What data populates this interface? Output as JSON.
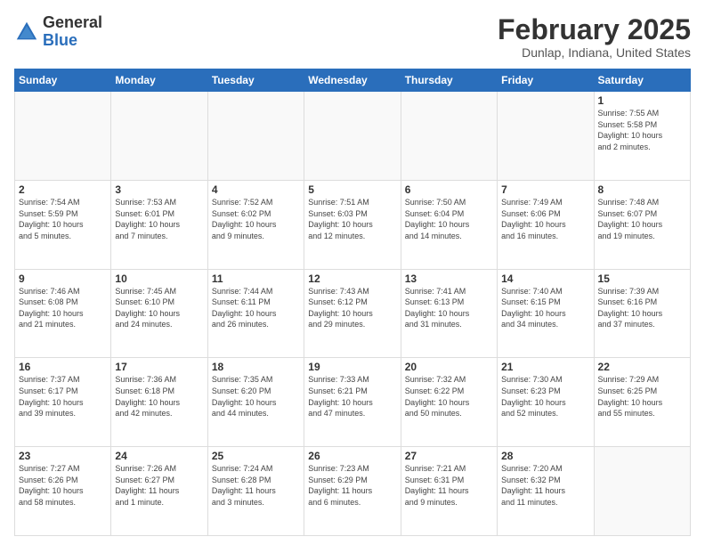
{
  "header": {
    "logo_general": "General",
    "logo_blue": "Blue",
    "main_title": "February 2025",
    "subtitle": "Dunlap, Indiana, United States"
  },
  "calendar": {
    "days_of_week": [
      "Sunday",
      "Monday",
      "Tuesday",
      "Wednesday",
      "Thursday",
      "Friday",
      "Saturday"
    ],
    "weeks": [
      [
        {
          "day": "",
          "info": ""
        },
        {
          "day": "",
          "info": ""
        },
        {
          "day": "",
          "info": ""
        },
        {
          "day": "",
          "info": ""
        },
        {
          "day": "",
          "info": ""
        },
        {
          "day": "",
          "info": ""
        },
        {
          "day": "1",
          "info": "Sunrise: 7:55 AM\nSunset: 5:58 PM\nDaylight: 10 hours\nand 2 minutes."
        }
      ],
      [
        {
          "day": "2",
          "info": "Sunrise: 7:54 AM\nSunset: 5:59 PM\nDaylight: 10 hours\nand 5 minutes."
        },
        {
          "day": "3",
          "info": "Sunrise: 7:53 AM\nSunset: 6:01 PM\nDaylight: 10 hours\nand 7 minutes."
        },
        {
          "day": "4",
          "info": "Sunrise: 7:52 AM\nSunset: 6:02 PM\nDaylight: 10 hours\nand 9 minutes."
        },
        {
          "day": "5",
          "info": "Sunrise: 7:51 AM\nSunset: 6:03 PM\nDaylight: 10 hours\nand 12 minutes."
        },
        {
          "day": "6",
          "info": "Sunrise: 7:50 AM\nSunset: 6:04 PM\nDaylight: 10 hours\nand 14 minutes."
        },
        {
          "day": "7",
          "info": "Sunrise: 7:49 AM\nSunset: 6:06 PM\nDaylight: 10 hours\nand 16 minutes."
        },
        {
          "day": "8",
          "info": "Sunrise: 7:48 AM\nSunset: 6:07 PM\nDaylight: 10 hours\nand 19 minutes."
        }
      ],
      [
        {
          "day": "9",
          "info": "Sunrise: 7:46 AM\nSunset: 6:08 PM\nDaylight: 10 hours\nand 21 minutes."
        },
        {
          "day": "10",
          "info": "Sunrise: 7:45 AM\nSunset: 6:10 PM\nDaylight: 10 hours\nand 24 minutes."
        },
        {
          "day": "11",
          "info": "Sunrise: 7:44 AM\nSunset: 6:11 PM\nDaylight: 10 hours\nand 26 minutes."
        },
        {
          "day": "12",
          "info": "Sunrise: 7:43 AM\nSunset: 6:12 PM\nDaylight: 10 hours\nand 29 minutes."
        },
        {
          "day": "13",
          "info": "Sunrise: 7:41 AM\nSunset: 6:13 PM\nDaylight: 10 hours\nand 31 minutes."
        },
        {
          "day": "14",
          "info": "Sunrise: 7:40 AM\nSunset: 6:15 PM\nDaylight: 10 hours\nand 34 minutes."
        },
        {
          "day": "15",
          "info": "Sunrise: 7:39 AM\nSunset: 6:16 PM\nDaylight: 10 hours\nand 37 minutes."
        }
      ],
      [
        {
          "day": "16",
          "info": "Sunrise: 7:37 AM\nSunset: 6:17 PM\nDaylight: 10 hours\nand 39 minutes."
        },
        {
          "day": "17",
          "info": "Sunrise: 7:36 AM\nSunset: 6:18 PM\nDaylight: 10 hours\nand 42 minutes."
        },
        {
          "day": "18",
          "info": "Sunrise: 7:35 AM\nSunset: 6:20 PM\nDaylight: 10 hours\nand 44 minutes."
        },
        {
          "day": "19",
          "info": "Sunrise: 7:33 AM\nSunset: 6:21 PM\nDaylight: 10 hours\nand 47 minutes."
        },
        {
          "day": "20",
          "info": "Sunrise: 7:32 AM\nSunset: 6:22 PM\nDaylight: 10 hours\nand 50 minutes."
        },
        {
          "day": "21",
          "info": "Sunrise: 7:30 AM\nSunset: 6:23 PM\nDaylight: 10 hours\nand 52 minutes."
        },
        {
          "day": "22",
          "info": "Sunrise: 7:29 AM\nSunset: 6:25 PM\nDaylight: 10 hours\nand 55 minutes."
        }
      ],
      [
        {
          "day": "23",
          "info": "Sunrise: 7:27 AM\nSunset: 6:26 PM\nDaylight: 10 hours\nand 58 minutes."
        },
        {
          "day": "24",
          "info": "Sunrise: 7:26 AM\nSunset: 6:27 PM\nDaylight: 11 hours\nand 1 minute."
        },
        {
          "day": "25",
          "info": "Sunrise: 7:24 AM\nSunset: 6:28 PM\nDaylight: 11 hours\nand 3 minutes."
        },
        {
          "day": "26",
          "info": "Sunrise: 7:23 AM\nSunset: 6:29 PM\nDaylight: 11 hours\nand 6 minutes."
        },
        {
          "day": "27",
          "info": "Sunrise: 7:21 AM\nSunset: 6:31 PM\nDaylight: 11 hours\nand 9 minutes."
        },
        {
          "day": "28",
          "info": "Sunrise: 7:20 AM\nSunset: 6:32 PM\nDaylight: 11 hours\nand 11 minutes."
        },
        {
          "day": "",
          "info": ""
        }
      ]
    ]
  }
}
